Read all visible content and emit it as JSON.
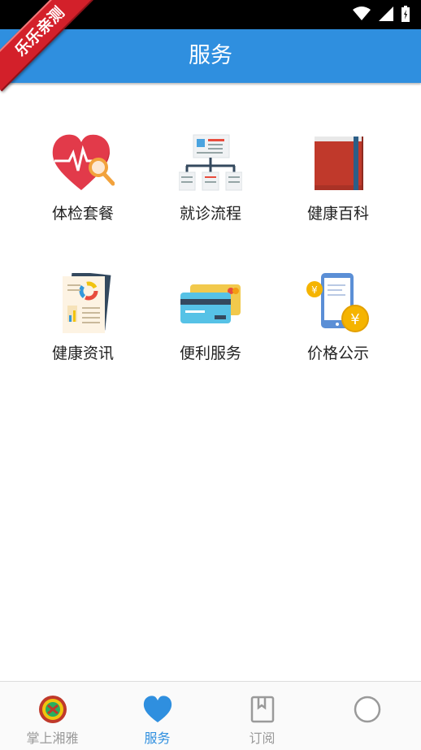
{
  "appbar": {
    "title": "服务"
  },
  "ribbon": {
    "text": "乐乐亲测"
  },
  "colors": {
    "primary": "#2f8fdf",
    "ribbon": "#d3202a"
  },
  "services": [
    {
      "label": "体检套餐",
      "icon": "heart-magnifier-icon"
    },
    {
      "label": "就诊流程",
      "icon": "flowchart-icon"
    },
    {
      "label": "健康百科",
      "icon": "book-icon"
    },
    {
      "label": "健康资讯",
      "icon": "news-document-icon"
    },
    {
      "label": "便利服务",
      "icon": "credit-card-icon"
    },
    {
      "label": "价格公示",
      "icon": "phone-yuan-icon"
    }
  ],
  "bottom_nav": [
    {
      "label": "掌上湘雅",
      "icon": "xiangya-logo-icon",
      "active": false
    },
    {
      "label": "服务",
      "icon": "heart-icon",
      "active": true
    },
    {
      "label": "订阅",
      "icon": "bookmark-icon",
      "active": false
    },
    {
      "label": "",
      "icon": "profile-circle-icon",
      "active": false
    }
  ]
}
